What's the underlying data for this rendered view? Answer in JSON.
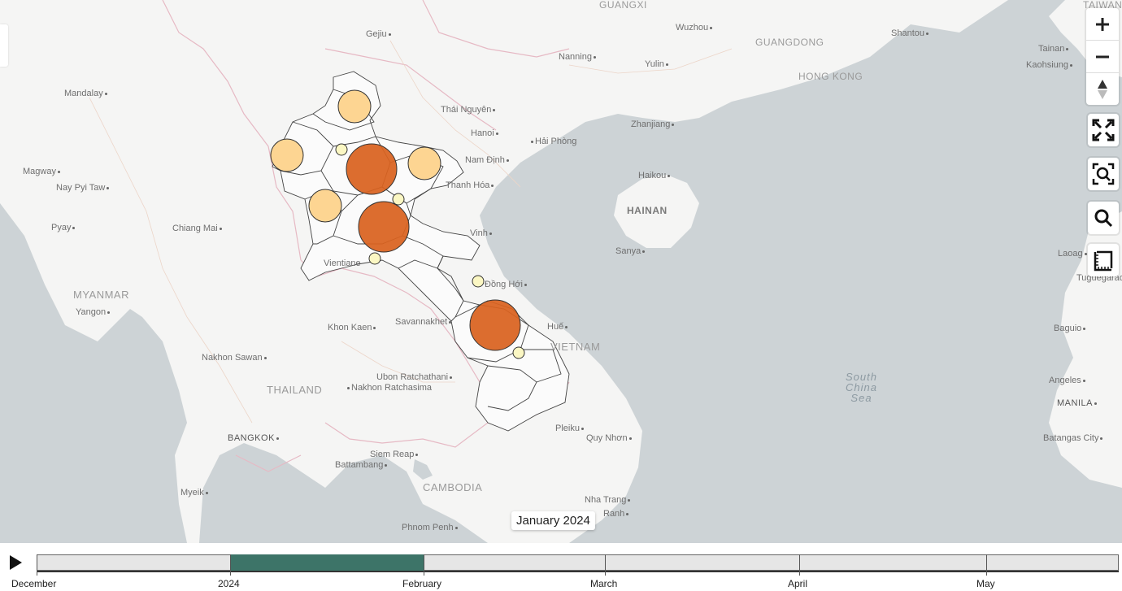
{
  "map": {
    "countries": [
      "MYANMAR",
      "THAILAND",
      "CAMBODIA",
      "VIETNAM",
      "HAINAN",
      "HONG KONG",
      "GUANGDONG",
      "GUANGXI",
      "TAIWAN"
    ],
    "sea": [
      "South",
      "China",
      "Sea"
    ],
    "places": [
      "Gejiu",
      "Wuzhou",
      "Shantou",
      "Nanning",
      "Yulin",
      "Mandalay",
      "Thái Nguyên",
      "Hanoi",
      "Hải Phòng",
      "Zhanjiang",
      "Nam Định",
      "Magway",
      "Nay Pyi Taw",
      "Haikou",
      "Thanh Hóa",
      "Pyay",
      "Chiang Mai",
      "Vinh",
      "Sanya",
      "Vientiane",
      "Đồng Hới",
      "Yangon",
      "Khon Kaen",
      "Savannakhet",
      "Huế",
      "Nakhon Sawan",
      "Ubon Ratchathani",
      "Nakhon Ratchasima",
      "BANGKOK",
      "Pleiku",
      "Quy Nhơn",
      "Siem Reap",
      "Battambang",
      "Myeik",
      "Nha Trang",
      "Ranh",
      "Phnom Penh",
      "Tainan",
      "Kaohsiung",
      "Laoag",
      "Tuguegarao",
      "Baguio",
      "Angeles",
      "MANILA",
      "Batangas City",
      "TAIWAN"
    ],
    "bubble_colors": {
      "large": "#d9621f",
      "medium": "#fdd592",
      "small": "#fbf7c3"
    },
    "bubbles": [
      {
        "size": "medium"
      },
      {
        "size": "medium"
      },
      {
        "size": "small"
      },
      {
        "size": "large"
      },
      {
        "size": "medium"
      },
      {
        "size": "medium"
      },
      {
        "size": "small"
      },
      {
        "size": "large"
      },
      {
        "size": "small"
      },
      {
        "size": "small"
      },
      {
        "size": "large"
      },
      {
        "size": "small"
      }
    ]
  },
  "controls": {
    "zoom_in_icon": "plus-icon",
    "zoom_out_icon": "minus-icon",
    "reset_north_icon": "compass-icon",
    "fullscreen_icon": "fullscreen-icon",
    "zoom_to_data_icon": "zoom-extent-icon",
    "search_icon": "search-icon",
    "legend_icon": "legend-icon"
  },
  "tooltip": {
    "text": "January 2024"
  },
  "timeline": {
    "play_icon": "play-icon",
    "labels": [
      "December",
      "2024",
      "February",
      "March",
      "April",
      "May"
    ],
    "selected_range": [
      "2024",
      "February"
    ],
    "accent_color": "#3d7468"
  }
}
